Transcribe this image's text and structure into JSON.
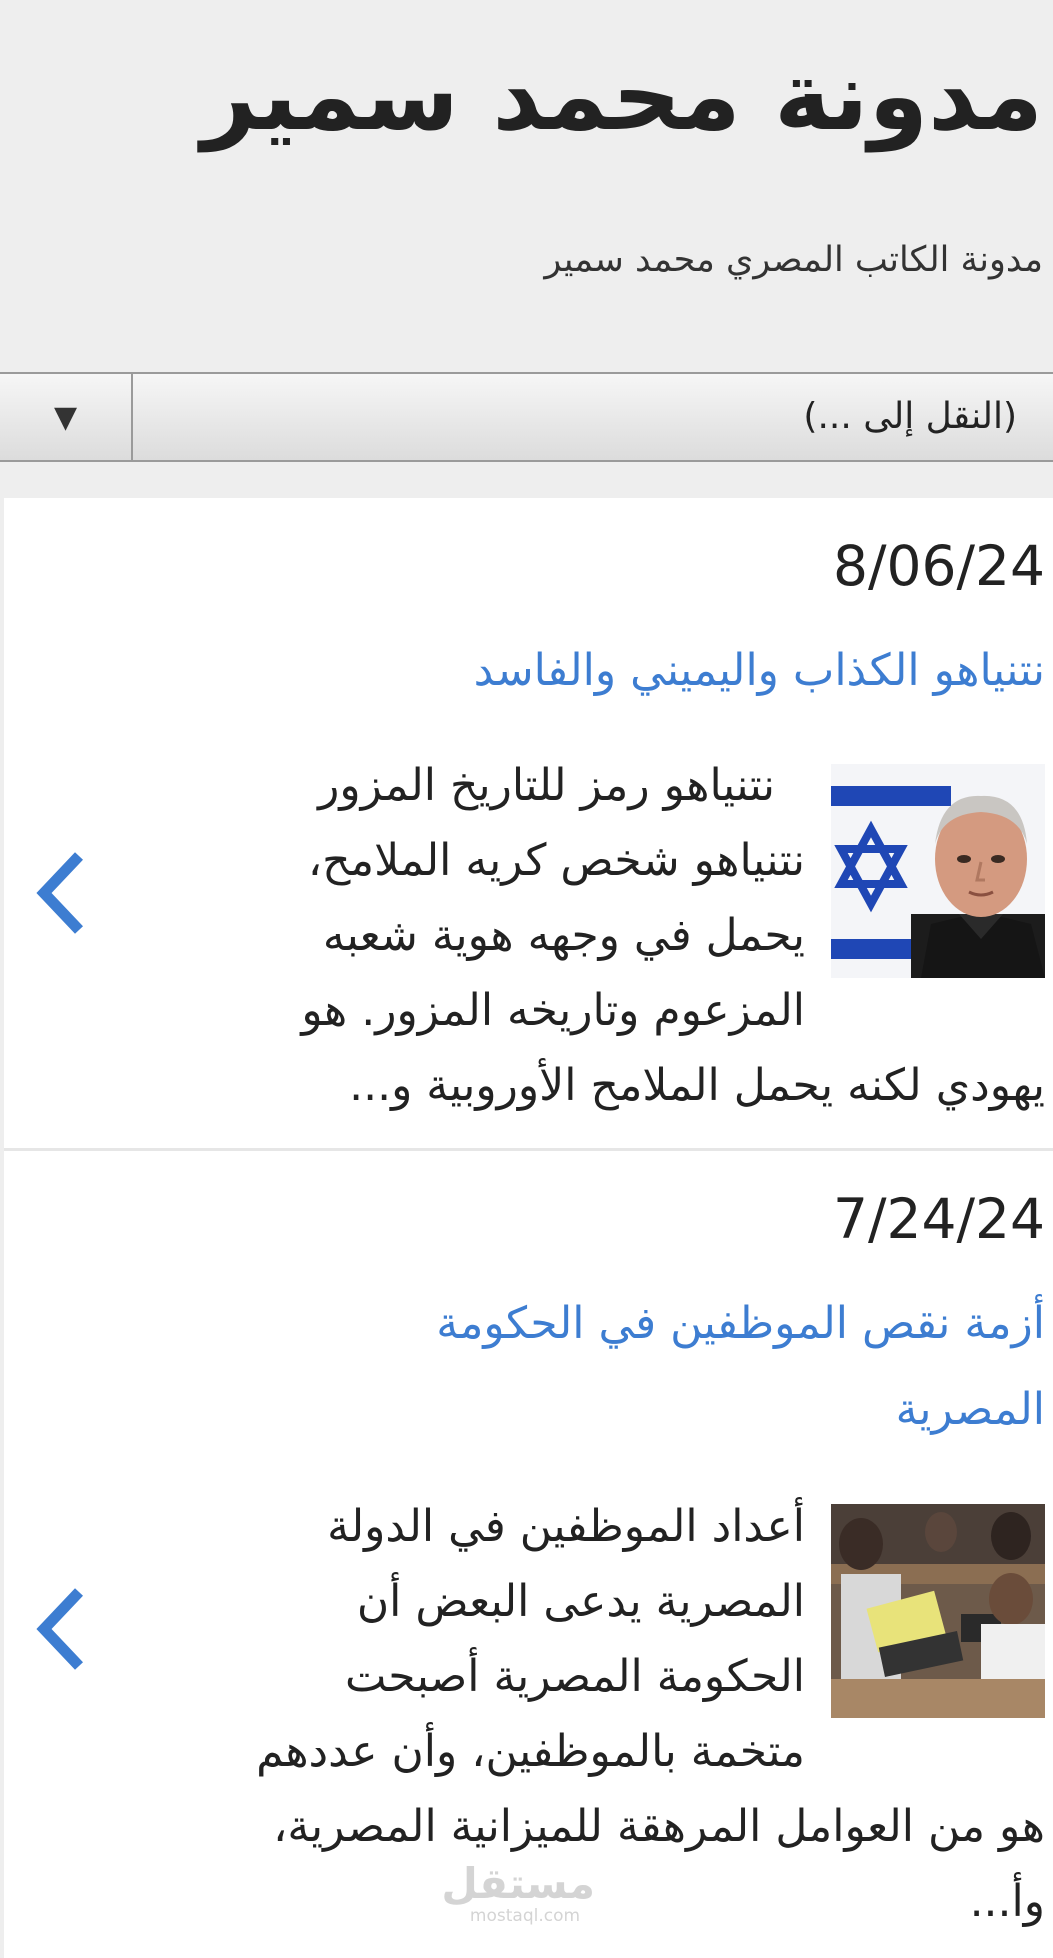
{
  "header": {
    "title": "مدونة محمد سمير",
    "description": "مدونة الكاتب المصري محمد سمير"
  },
  "nav": {
    "label": "(النقل إلى ...)",
    "arrow": "▼"
  },
  "posts": [
    {
      "date": "8/06/24",
      "title_lines": [
        "نتنياهو الكذاب واليميني والفاسد"
      ],
      "snippet_lines": [
        "نتنياهو رمز للتاريخ المزور",
        "نتنياهو شخص كريه الملامح،",
        "يحمل في وجهه هوية شعبه",
        "المزعوم وتاريخه المزور. هو",
        "يهودي لكنه يحمل الملامح الأوروبية و..."
      ],
      "thumbnail_icon": "portrait-with-flag-image",
      "next_icon": "chevron-left-icon"
    },
    {
      "date": "7/24/24",
      "title_lines": [
        "أزمة نقص الموظفين في الحكومة",
        "المصرية"
      ],
      "snippet_lines": [
        "أعداد الموظفين في الدولة",
        "المصرية  يدعى البعض أن",
        "الحكومة المصرية أصبحت",
        "متخمة بالموظفين، وأن عددهم",
        "هو من العوامل المرهقة للميزانية المصرية،",
        "وأ..."
      ],
      "thumbnail_icon": "office-workers-image",
      "next_icon": "chevron-left-icon"
    }
  ],
  "watermark": {
    "arabic": "مستقل",
    "latin": "mostaql.com"
  },
  "colors": {
    "link": "#3d7dd1",
    "page_background": "#eeeeee",
    "content_background": "#ffffff"
  }
}
